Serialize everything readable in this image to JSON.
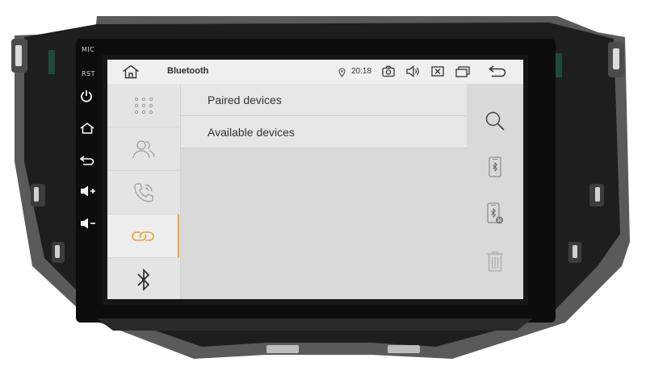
{
  "hardware": {
    "mic_label": "MIC",
    "rst_label": "RST",
    "buttons": [
      "power-icon",
      "home-icon",
      "back-icon",
      "volume-up-icon",
      "volume-down-icon"
    ]
  },
  "statusbar": {
    "home_icon": "home-icon",
    "title": "Bluetooth",
    "location_icon": "location-pin-icon",
    "time": "20:18",
    "icons": [
      "camera-icon",
      "speaker-icon",
      "close-window-icon",
      "windows-icon",
      "back-arrow-icon"
    ]
  },
  "nav": {
    "items": [
      {
        "icon": "dialpad-icon",
        "active": false
      },
      {
        "icon": "contacts-icon",
        "active": false
      },
      {
        "icon": "call-log-icon",
        "active": false
      },
      {
        "icon": "pairing-link-icon",
        "active": true
      },
      {
        "icon": "bluetooth-icon",
        "active": false
      }
    ]
  },
  "devices": {
    "paired_label": "Paired devices",
    "available_label": "Available devices"
  },
  "actions": {
    "icons": [
      "search-icon",
      "phone-bluetooth-icon",
      "phone-disconnect-icon",
      "trash-icon"
    ]
  },
  "colors": {
    "accent": "#e6a23c",
    "screen_bg": "#d9d9d9",
    "bezel": "#1c1c1c"
  }
}
